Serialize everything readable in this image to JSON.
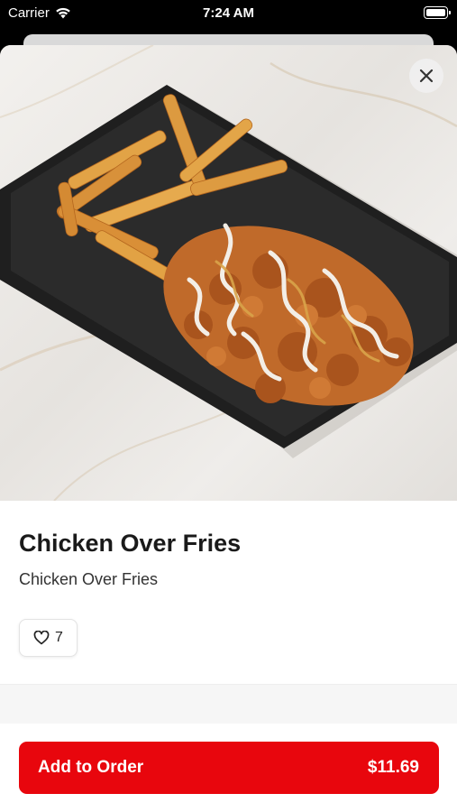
{
  "status_bar": {
    "carrier": "Carrier",
    "time": "7:24 AM"
  },
  "item": {
    "name": "Chicken Over Fries",
    "description": "Chicken Over Fries",
    "likes": "7"
  },
  "order": {
    "button_label": "Add to Order",
    "price": "$11.69"
  },
  "colors": {
    "accent": "#e8060d",
    "background": "#ffffff",
    "title": "#1a1a1a"
  }
}
